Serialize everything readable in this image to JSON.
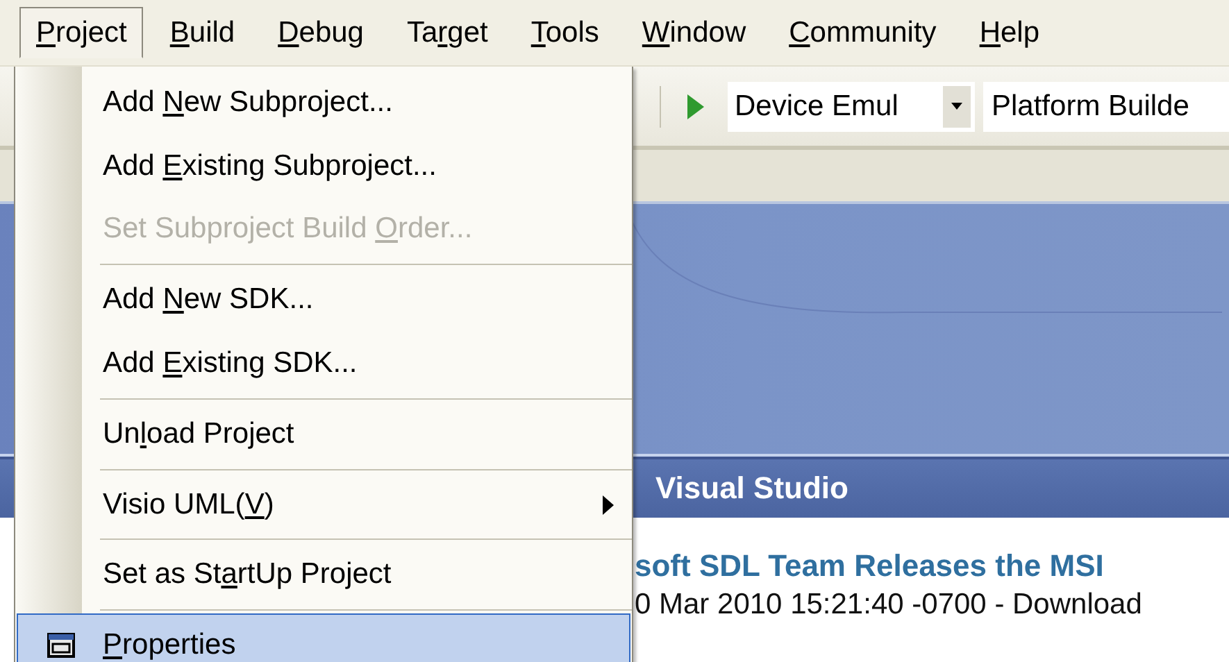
{
  "menubar": [
    {
      "key": "P",
      "after": "roject",
      "selected": true
    },
    {
      "key": "B",
      "after": "uild",
      "selected": false
    },
    {
      "key": "D",
      "after": "ebug",
      "selected": false
    },
    {
      "before": "Ta",
      "key": "r",
      "after": "get",
      "selected": false
    },
    {
      "key": "T",
      "after": "ools",
      "selected": false
    },
    {
      "key": "W",
      "after": "indow",
      "selected": false
    },
    {
      "key": "C",
      "after": "ommunity",
      "selected": false
    },
    {
      "key": "H",
      "after": "elp",
      "selected": false
    }
  ],
  "dropdown": {
    "items": [
      {
        "kind": "item",
        "before": "Add ",
        "key": "N",
        "after": "ew Subproject...",
        "disabled": false,
        "selected": false,
        "submenu": false
      },
      {
        "kind": "item",
        "before": "Add ",
        "key": "E",
        "after": "xisting Subproject...",
        "disabled": false,
        "selected": false,
        "submenu": false
      },
      {
        "kind": "item",
        "before": "Set Subproject Build ",
        "key": "O",
        "after": "rder...",
        "disabled": true,
        "selected": false,
        "submenu": false
      },
      {
        "kind": "separator"
      },
      {
        "kind": "item",
        "before": "Add ",
        "key": "N",
        "after": "ew SDK...",
        "disabled": false,
        "selected": false,
        "submenu": false
      },
      {
        "kind": "item",
        "before": "Add ",
        "key": "E",
        "after": "xisting SDK...",
        "disabled": false,
        "selected": false,
        "submenu": false
      },
      {
        "kind": "separator"
      },
      {
        "kind": "item",
        "before": "Un",
        "key": "l",
        "after": "oad Project",
        "disabled": false,
        "selected": false,
        "submenu": false
      },
      {
        "kind": "separator"
      },
      {
        "kind": "item",
        "before": "Visio UML(",
        "key": "V",
        "after": ")",
        "disabled": false,
        "selected": false,
        "submenu": true
      },
      {
        "kind": "separator"
      },
      {
        "kind": "item",
        "before": "Set as St",
        "key": "a",
        "after": "rtUp Project",
        "disabled": false,
        "selected": false,
        "submenu": false
      },
      {
        "kind": "separator"
      },
      {
        "kind": "item",
        "key": "P",
        "after": "roperties",
        "disabled": false,
        "selected": true,
        "submenu": false,
        "icon": true
      }
    ]
  },
  "toolbar": {
    "device": "Device Emul",
    "platform": "Platform Builde"
  },
  "start_page": {
    "header": "Visual Studio",
    "news_title": "soft SDL Team Releases the MSI",
    "news_meta": "0 Mar 2010 15:21:40 -0700 -  Download"
  }
}
